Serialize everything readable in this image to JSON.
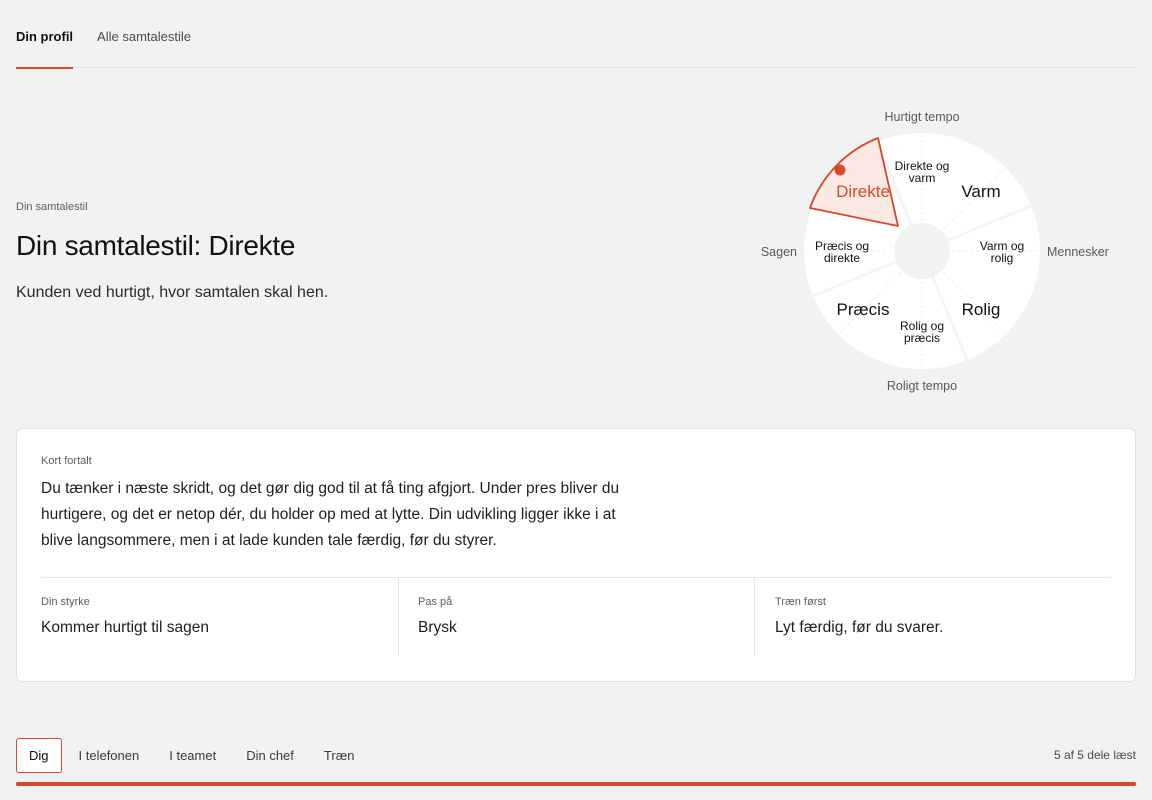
{
  "top_tabs": [
    {
      "label": "Din profil",
      "active": true
    },
    {
      "label": "Alle samtalestile",
      "active": false
    }
  ],
  "hero": {
    "eyebrow": "Din samtalestil",
    "title": "Din samtalestil: Direkte",
    "subtitle": "Kunden ved hurtigt, hvor samtalen skal hen."
  },
  "wheel": {
    "axis": {
      "top": "Hurtigt tempo",
      "bottom": "Roligt tempo",
      "left": "Sagen",
      "right": "Mennesker"
    },
    "segments": {
      "direkte": "Direkte",
      "direkte_og_varm_1": "Direkte og",
      "direkte_og_varm_2": "varm",
      "varm": "Varm",
      "varm_og_rolig_1": "Varm og",
      "varm_og_rolig_2": "rolig",
      "rolig": "Rolig",
      "rolig_og_praecis_1": "Rolig og",
      "rolig_og_praecis_2": "præcis",
      "praecis": "Præcis",
      "praecis_og_direkte_1": "Præcis og",
      "praecis_og_direkte_2": "direkte"
    },
    "active_segment": "Direkte",
    "accent_color": "#d6482a",
    "active_fill": "#fbe9e4"
  },
  "card": {
    "label": "Kort fortalt",
    "lines": [
      "Du tænker i næste skridt, og det gør dig god til at få ting afgjort. Under pres bliver du",
      "hurtigere, og det er netop dér, du holder op med at lytte. Din udvikling ligger ikke i at",
      "blive langsommere, men i at lade kunden tale færdig, før du styrer."
    ],
    "columns": [
      {
        "label": "Din styrke",
        "value": "Kommer hurtigt til sagen"
      },
      {
        "label": "Pas på",
        "value": "Brysk"
      },
      {
        "label": "Træn først",
        "value": "Lyt færdig, før du svarer."
      }
    ]
  },
  "bottom_tabs": [
    {
      "label": "Dig",
      "active": true
    },
    {
      "label": "I telefonen",
      "active": false
    },
    {
      "label": "I teamet",
      "active": false
    },
    {
      "label": "Din chef",
      "active": false
    },
    {
      "label": "Træn",
      "active": false
    }
  ],
  "progress": {
    "status_text": "5 af 5 dele læst",
    "read": 5,
    "total": 5
  }
}
